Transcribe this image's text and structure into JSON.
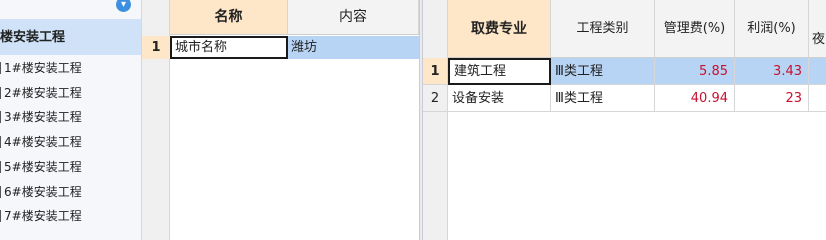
{
  "tree": {
    "collapse_icon": "chevron-down-circle-icon",
    "root_label": "楼安装工程",
    "items": [
      {
        "label": "1#楼安装工程"
      },
      {
        "label": "2#楼安装工程"
      },
      {
        "label": "3#楼安装工程"
      },
      {
        "label": "4#楼安装工程"
      },
      {
        "label": "5#楼安装工程"
      },
      {
        "label": "6#楼安装工程"
      },
      {
        "label": "7#楼安装工程"
      }
    ]
  },
  "mid_grid": {
    "headers": {
      "name": "名称",
      "content": "内容"
    },
    "rows": [
      {
        "num": "1",
        "name": "城市名称",
        "content": "潍坊"
      }
    ]
  },
  "right_grid": {
    "headers": {
      "specialty": "取费专业",
      "category": "工程类别",
      "mgmt_fee": "管理费(%)",
      "profit": "利润(%)",
      "extra": "夜"
    },
    "rows": [
      {
        "num": "1",
        "specialty": "建筑工程",
        "category": "Ⅲ类工程",
        "mgmt_fee": "5.85",
        "profit": "3.43"
      },
      {
        "num": "2",
        "specialty": "设备安装",
        "category": "Ⅲ类工程",
        "mgmt_fee": "40.94",
        "profit": "23"
      }
    ]
  },
  "colors": {
    "selection": "#b8d4f5",
    "header_highlight": "#fde7c8",
    "number_red": "#c8102e",
    "tree_selected": "#cfe2f7"
  }
}
